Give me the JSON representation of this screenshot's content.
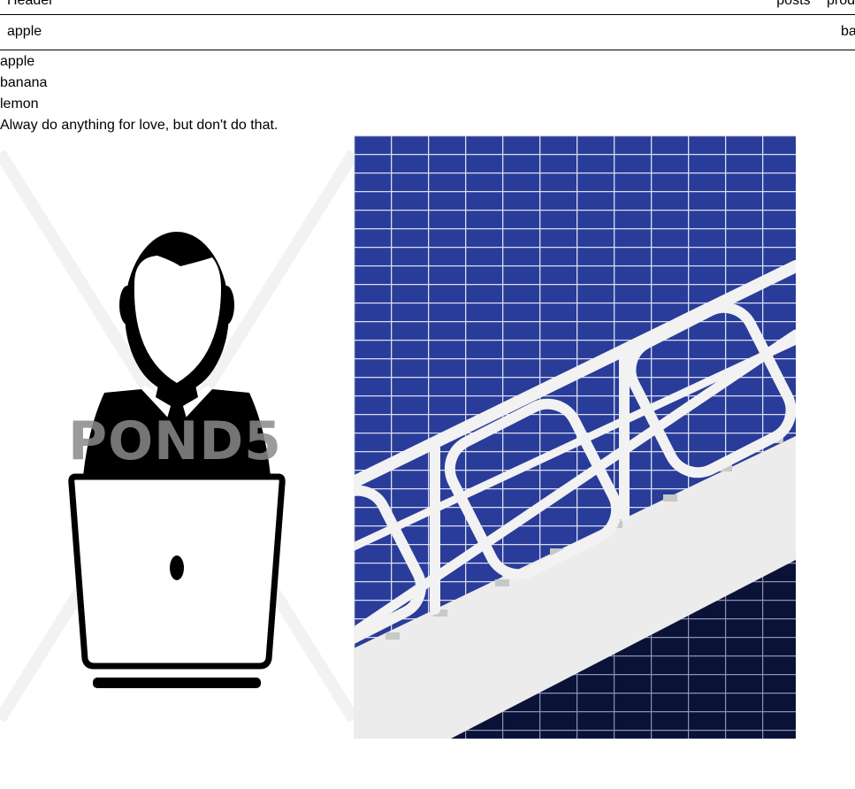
{
  "header": {
    "title": "Header",
    "nav": [
      "posts",
      "prod"
    ]
  },
  "tabs": {
    "left": "apple",
    "right": "ba"
  },
  "list": [
    "apple",
    "banana",
    "lemon"
  ],
  "quote": "Alway do anything for love, but don't do that.",
  "images": {
    "person": {
      "watermark": "POND5",
      "icon": "person-with-laptop-icon"
    },
    "stairs": {
      "colors": {
        "tiles": "#2a3c99",
        "railing": "#f2f2f2",
        "dark_tiles": "#0b1238"
      }
    }
  }
}
